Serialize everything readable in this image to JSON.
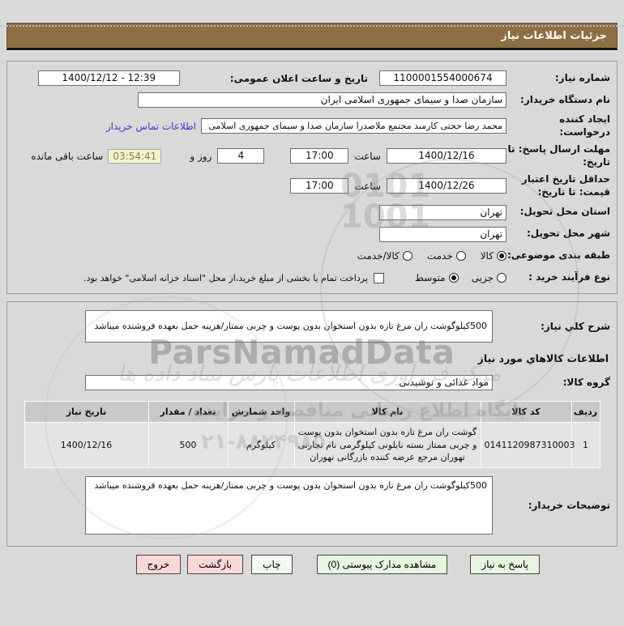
{
  "window": {
    "title": "جزئیات اطلاعات نیاز"
  },
  "form": {
    "need_number": {
      "label": "شماره نیاز:",
      "value": "1100001554000674"
    },
    "announce": {
      "label": "تاریخ و ساعت اعلان عمومی:",
      "value": "1400/12/12 - 12:39"
    },
    "buyer_org": {
      "label": "نام دستگاه خریدار:",
      "value": "سازمان صدا و سیمای جمهوری اسلامی ایران"
    },
    "requester": {
      "label": "ایجاد کننده درخواست:",
      "value": "محمد رضا حجتی کارمند مجتمع ملاصدرا سازمان صدا و سیمای جمهوری اسلامی",
      "contact_link": "اطلاعات تماس خریدار"
    },
    "deadline": {
      "label": "مهلت ارسال پاسخ: تا تاریخ:",
      "date": "1400/12/16",
      "hour_label": "ساعت",
      "time": "17:00",
      "days": "4",
      "days_label": "روز و",
      "countdown": "03:54:41",
      "remaining_label": "ساعت باقی مانده"
    },
    "validity": {
      "label": "حداقل تاریخ اعتبار قیمت: تا تاریخ:",
      "date": "1400/12/26",
      "hour_label": "ساعت",
      "time": "17:00"
    },
    "province": {
      "label": "استان محل تحویل:",
      "value": "تهران"
    },
    "city": {
      "label": "شهر محل تحویل:",
      "value": "تهران"
    },
    "classification": {
      "label": "طبقه بندی موضوعی:",
      "options": [
        "کالا",
        "خدمت",
        "کالا/خدمت"
      ],
      "selected": "کالا"
    },
    "process": {
      "label": "نوع فرآیند خرید :",
      "options": [
        "جزیی",
        "متوسط"
      ],
      "selected": "متوسط",
      "treasury_note": "پرداخت تمام یا بخشی از مبلغ خرید،از محل \"اسناد خزانه اسلامی\" خواهد بود."
    }
  },
  "need": {
    "desc_label": "شرح کلي نياز:",
    "desc": "500کیلوگوشت ران مرغ تازه بدون استخوان بدون پوست و چربی ممتاز/هزینه حمل بعهده فروشنده میباشد",
    "goods_header": "اطلاعات کالاهاي مورد نياز",
    "group_label": "گروه کالا:",
    "group_value": "مواد غذائی و نوشیدنی",
    "table": {
      "headers": [
        "ردیف",
        "کد کالا",
        "نام کالا",
        "واحد شمارش",
        "تعداد / مقدار",
        "تاریخ نیاز"
      ],
      "rows": [
        [
          "1",
          "0141120987310003",
          "گوشت ران مرغ تازه بدون استخوان بدون پوست و چربی ممتاز بسته نایلونی کیلوگرمی نام تجارتی تهوران مرجع عرضه کننده بازرگانی تهوران",
          "کیلوگرم",
          "500",
          "1400/12/16"
        ]
      ]
    },
    "notes_label": "توضیحات خریدار:",
    "notes": "500کیلوگوشت ران مرغ تازه بدون استخوان بدون پوست و چربی ممتاز/هزینه حمل بعهده فروشنده میباشد"
  },
  "buttons": {
    "respond": "پاسخ به نیاز",
    "attachments": "مشاهده مدارک پیوستی (0)",
    "print": "چاپ",
    "back": "بازگشت",
    "exit": "خروج"
  },
  "watermark": {
    "brand": "ParsNamadData",
    "script_line": "مرکز فن آوری اطلاعات پارس نماد داده ها",
    "line1": "پایگاه اطلاع رسانی مناقصه و مزایده",
    "digits": "0101 1001",
    "phone": "۲۱-۸۸۲۴۹۸۵۰"
  },
  "colors": {
    "title_bar": "#8e6e44",
    "link": "#3c3cc8",
    "countdown_bg": "#f6f2cf",
    "countdown_text": "#8a8444",
    "button_green": "#e7f6de",
    "button_pale": "#f3faf0",
    "button_pink": "#fbd8d8"
  }
}
